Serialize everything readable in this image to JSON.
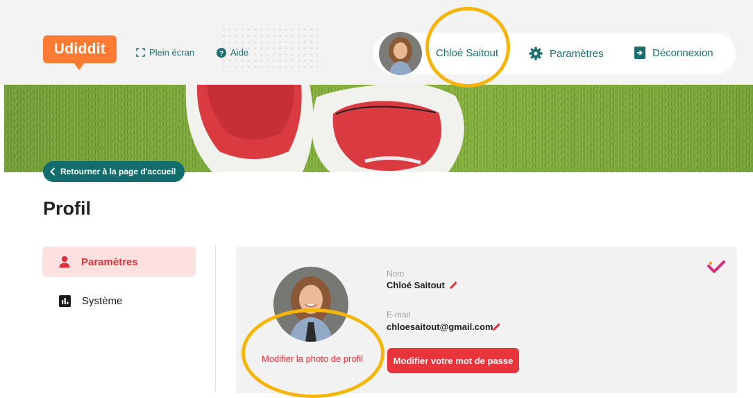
{
  "header": {
    "logo": "Udiddit",
    "fullscreen_label": "Plein écran",
    "help_label": "Aide",
    "user_name": "Chloé Saitout",
    "settings_label": "Paramètres",
    "logout_label": "Déconnexion"
  },
  "banner": {
    "back_label": "Retourner à la page d'accueil"
  },
  "page": {
    "title": "Profil"
  },
  "sidebar": {
    "items": [
      {
        "label": "Paramètres",
        "icon": "person-icon",
        "active": true
      },
      {
        "label": "Système",
        "icon": "bar-chart-icon",
        "active": false
      }
    ]
  },
  "profile": {
    "name_label": "Nom",
    "name_value": "Chloé Saitout",
    "email_label": "E-mail",
    "email_value": "chloesaitout@gmail.com",
    "change_photo_label": "Modifier la photo de profil",
    "change_password_label": "Modifier votre mot de passe"
  },
  "colors": {
    "brand_orange": "#ff7b33",
    "teal": "#1a6e6e",
    "accent_red": "#e8343b",
    "highlight_ring": "#f5b50a"
  }
}
